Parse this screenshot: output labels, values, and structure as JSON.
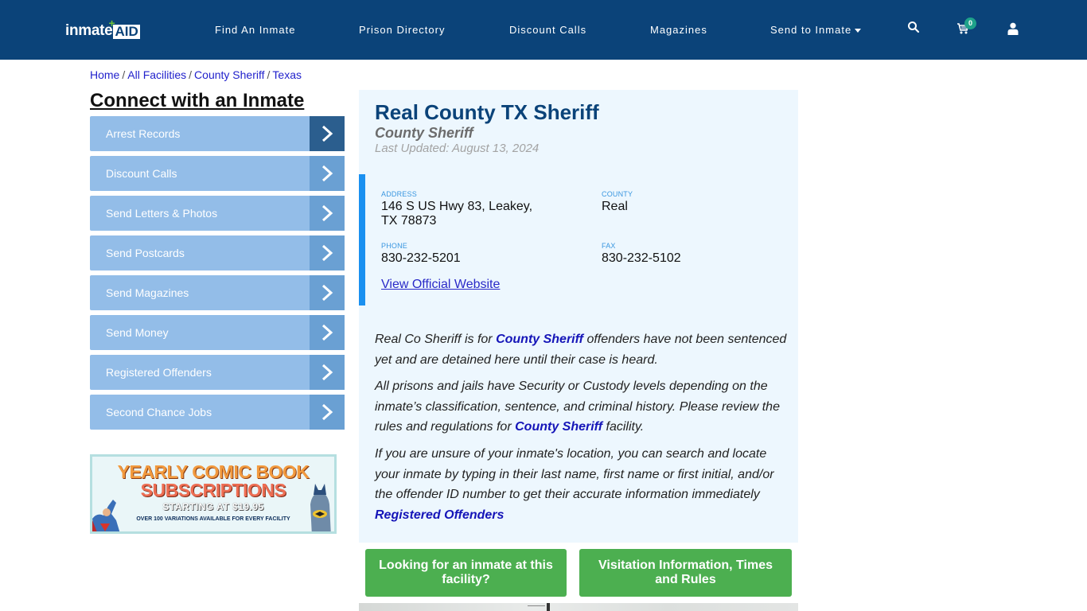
{
  "navbar": {
    "logo_text": "inmate",
    "logo_aid": "AID",
    "logo_plus": "+",
    "links": [
      "Find An Inmate",
      "Prison Directory",
      "Discount Calls",
      "Magazines",
      "Send to Inmate"
    ],
    "cart_count": "0",
    "icons": {
      "search": "search-icon",
      "cart": "cart-icon",
      "user": "user-icon",
      "dropdown": "caret-down-icon"
    }
  },
  "breadcrumb": [
    "Home",
    "All Facilities",
    "County Sheriff",
    "Texas"
  ],
  "breadcrumb_sep": "/",
  "sidebar": {
    "title": "Connect with an Inmate",
    "items": [
      {
        "label": "Arrest Records"
      },
      {
        "label": "Discount Calls"
      },
      {
        "label": "Send Letters & Photos"
      },
      {
        "label": "Send Postcards"
      },
      {
        "label": "Send Magazines"
      },
      {
        "label": "Send Money"
      },
      {
        "label": "Registered Offenders"
      },
      {
        "label": "Second Chance Jobs"
      }
    ],
    "ad": {
      "line1": "YEARLY COMIC BOOK",
      "line2": "SUBSCRIPTIONS",
      "line3": "STARTING AT $19.95",
      "line4": "OVER 100 VARIATIONS AVAILABLE FOR EVERY FACILITY"
    }
  },
  "facility": {
    "title": "Real County TX Sheriff",
    "type": "County Sheriff",
    "last_updated": "Last Updated: August 13, 2024",
    "address_label": "ADDRESS",
    "address_line1": "146 S US Hwy 83, Leakey,",
    "address_line2": "TX 78873",
    "county_label": "COUNTY",
    "county": "Real",
    "phone_label": "PHONE",
    "phone": "830-232-5201",
    "fax_label": "FAX",
    "fax": "830-232-5102",
    "website_link": "View Official Website"
  },
  "description": {
    "p1_a": "Real Co Sheriff is for ",
    "p1_b": "County Sheriff",
    "p1_c": " offenders have not been sentenced yet and are detained here until their case is heard.",
    "p2_a": "All prisons and jails have Security or Custody levels depending on the inmate’s classification, sentence, and criminal history. Please review the rules and regulations for ",
    "p2_b": "County Sheriff",
    "p2_c": " facility.",
    "p3_a": "If you are unsure of your inmate's location, you can search and locate your inmate by typing in their last name, first name or first initial, and/or the offender ID number to get their accurate information immediately",
    "p3_link": "Registered Offenders"
  },
  "buttons": {
    "looking": "Looking for an inmate at this facility?",
    "visitation": "Visitation Information, Times and Rules"
  },
  "colors": {
    "navbar": "#0b4379",
    "sidebar_item": "#93bde8",
    "sidebar_arrow": "#6aa0d3",
    "sidebar_arrow_active": "#2b5e8e",
    "panel_bg": "#edf7fe",
    "accent_bar": "#1a90f0",
    "green_button": "#4caf50",
    "link": "#1515b8"
  }
}
